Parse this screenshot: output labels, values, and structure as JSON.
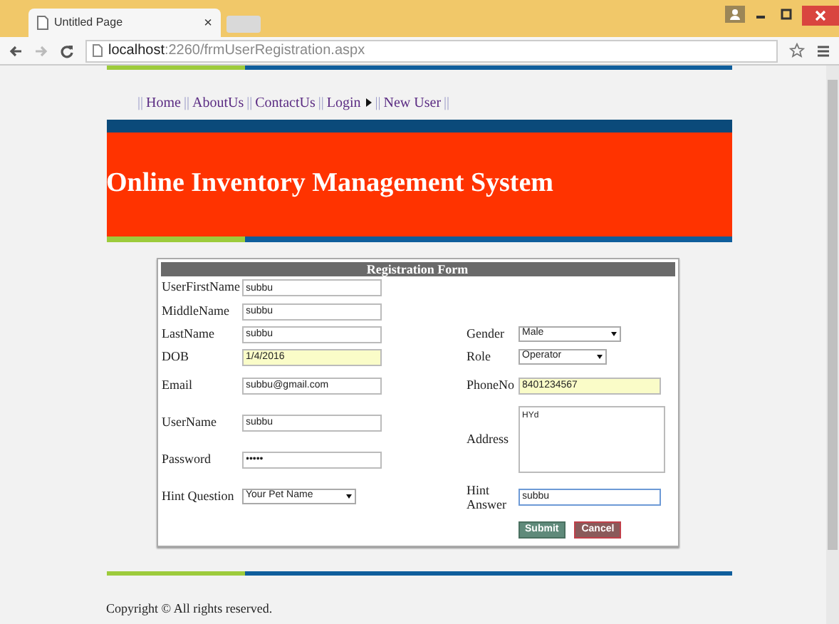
{
  "browser": {
    "tab_title": "Untitled Page",
    "tab_close": "×",
    "url_host": "localhost",
    "url_path": ":2260/frmUserRegistration.aspx"
  },
  "nav": [
    {
      "label": "Home"
    },
    {
      "label": "AboutUs"
    },
    {
      "label": "ContactUs"
    },
    {
      "label": "Login",
      "submenu": true
    },
    {
      "label": "New User"
    }
  ],
  "nav_separator": "||",
  "header": {
    "title": "Online Inventory Management System"
  },
  "form": {
    "title": "Registration Form",
    "rows": [
      {
        "left": {
          "label": "UserFirstName",
          "kind": "text",
          "value": "subbu",
          "autofilled": false
        }
      },
      {
        "left": {
          "label": "MiddleName",
          "kind": "text",
          "value": "subbu",
          "autofilled": false
        }
      },
      {
        "left": {
          "label": "LastName",
          "kind": "text",
          "value": "subbu",
          "autofilled": false
        },
        "right": {
          "label": "Gender",
          "kind": "select",
          "value": "Male"
        }
      },
      {
        "left": {
          "label": "DOB",
          "kind": "text",
          "value": "1/4/2016",
          "autofilled": true
        },
        "right": {
          "label": "Role",
          "kind": "select",
          "value": "Operator"
        }
      },
      {
        "left": {
          "label": "Email",
          "kind": "text",
          "value": "subbu@gmail.com",
          "autofilled": false
        },
        "right": {
          "label": "PhoneNo",
          "kind": "text",
          "value": "8401234567",
          "autofilled": true
        }
      },
      {
        "left": {
          "label": "UserName",
          "kind": "text",
          "value": "subbu",
          "autofilled": false
        },
        "right": {
          "label": "Address",
          "kind": "textarea",
          "value": "HYd"
        }
      },
      {
        "left": {
          "label": "Password",
          "kind": "password",
          "value": "•••••",
          "autofilled": false
        }
      },
      {
        "left": {
          "label": "Hint Question",
          "kind": "select",
          "value": "Your Pet Name"
        },
        "right": {
          "label": "Hint Answer",
          "kind": "text",
          "value": "subbu",
          "autofilled": false,
          "focused": true
        }
      }
    ],
    "buttons": [
      {
        "label": "Submit",
        "kind": "submit"
      },
      {
        "label": "Cancel",
        "kind": "cancel"
      }
    ]
  },
  "footer": {
    "text": "Copyright ©  All rights reserved."
  }
}
